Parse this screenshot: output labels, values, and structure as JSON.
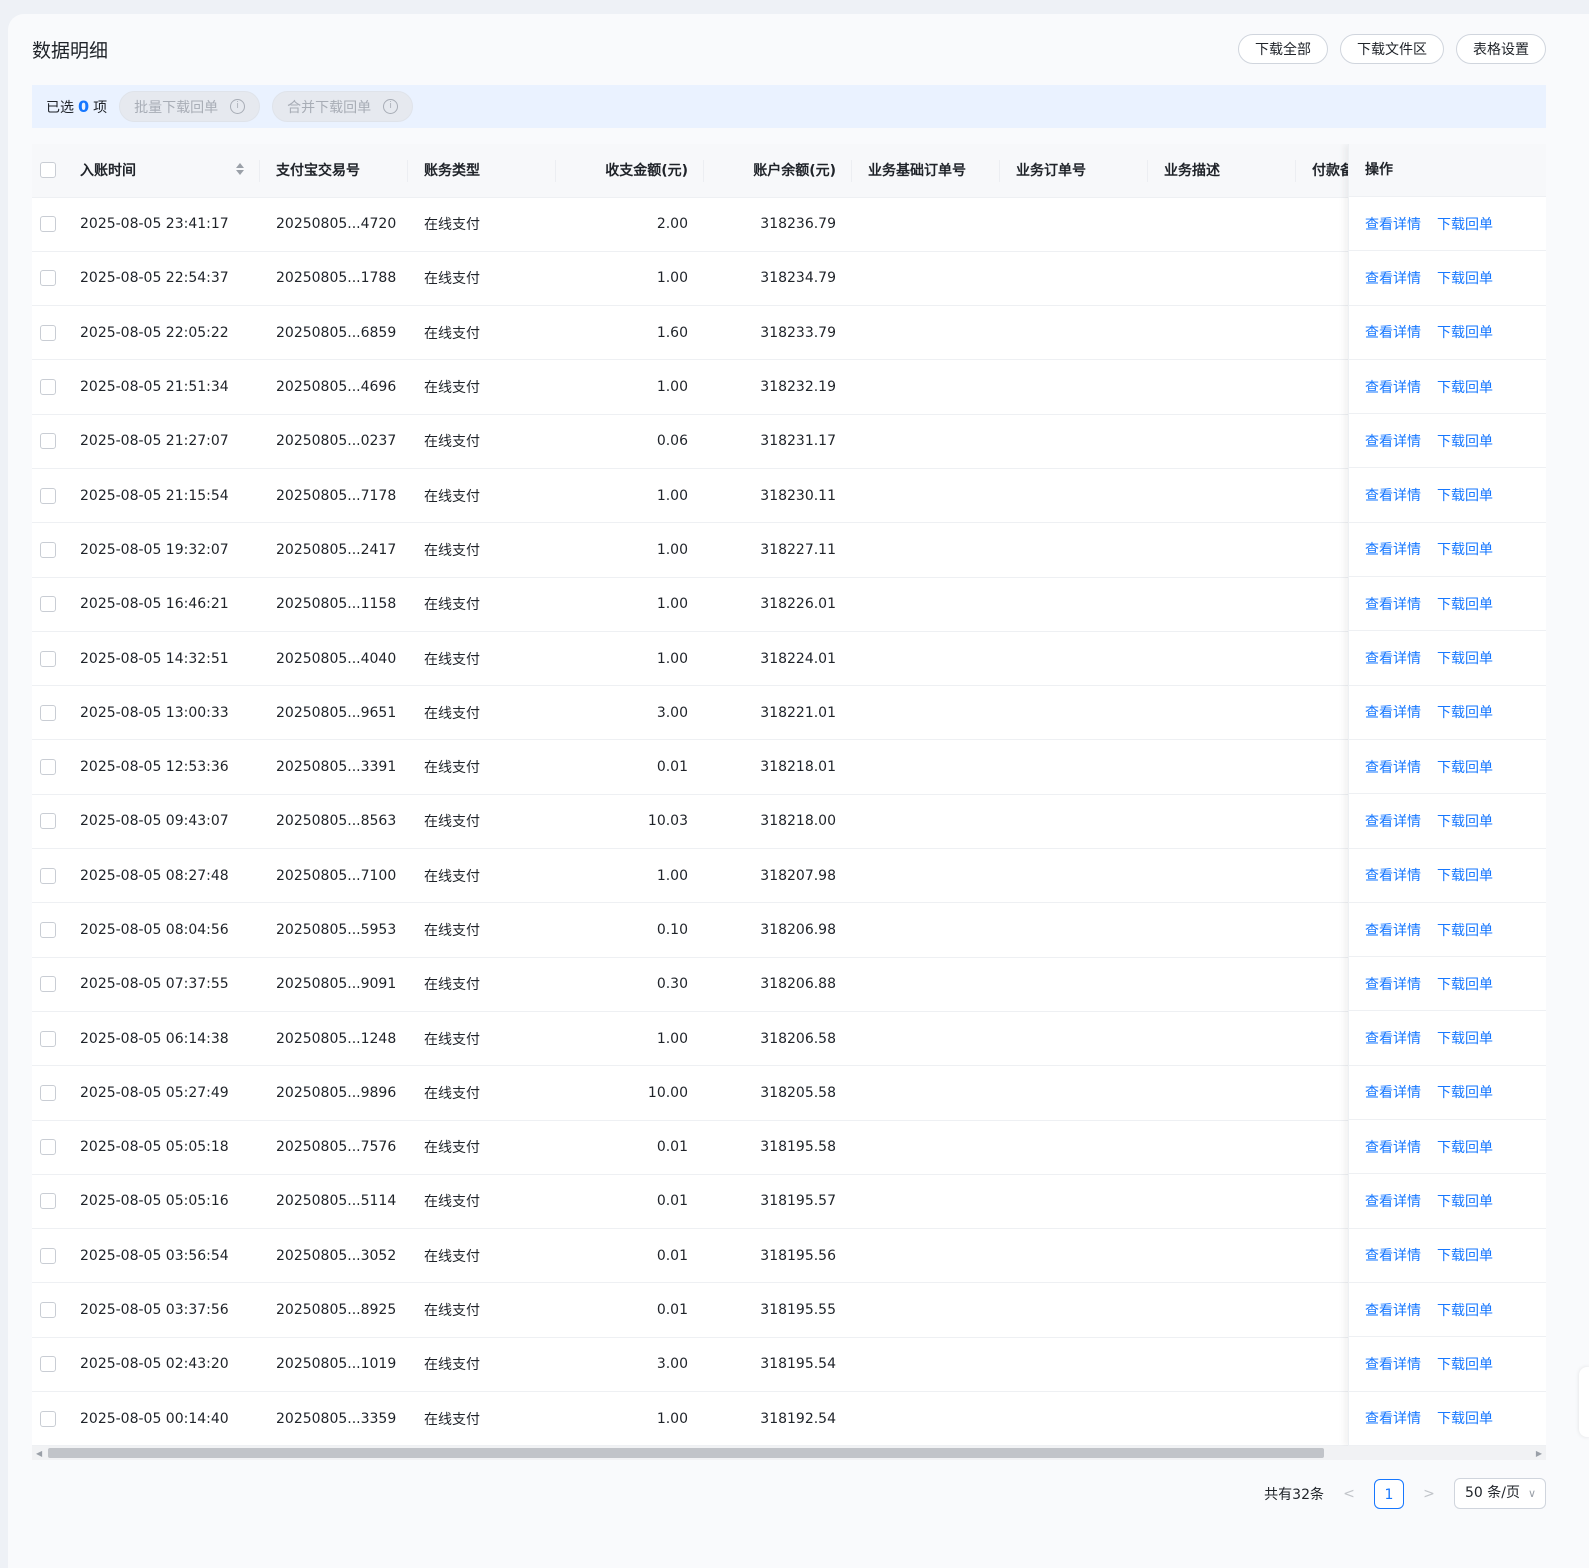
{
  "page": {
    "title": "数据明细"
  },
  "toolbar": {
    "download_all": "下载全部",
    "download_area": "下载文件区",
    "table_settings": "表格设置"
  },
  "selection": {
    "prefix": "已选",
    "count": "0",
    "suffix": "项",
    "batch_download": "批量下载回单",
    "merge_download": "合并下载回单"
  },
  "table": {
    "columns": {
      "time": "入账时间",
      "trade_no": "支付宝交易号",
      "type": "账务类型",
      "amount": "收支金额(元)",
      "balance": "账户余额(元)",
      "base_order": "业务基础订单号",
      "order": "业务订单号",
      "desc": "业务描述",
      "payer": "付款备",
      "actions": "操作"
    },
    "action_labels": {
      "detail": "查看详情",
      "download": "下载回单"
    },
    "rows": [
      {
        "time": "2025-08-05 23:41:17",
        "trade_no": "20250805...4720",
        "type": "在线支付",
        "amount": "2.00",
        "balance": "318236.79"
      },
      {
        "time": "2025-08-05 22:54:37",
        "trade_no": "20250805...1788",
        "type": "在线支付",
        "amount": "1.00",
        "balance": "318234.79"
      },
      {
        "time": "2025-08-05 22:05:22",
        "trade_no": "20250805...6859",
        "type": "在线支付",
        "amount": "1.60",
        "balance": "318233.79"
      },
      {
        "time": "2025-08-05 21:51:34",
        "trade_no": "20250805...4696",
        "type": "在线支付",
        "amount": "1.00",
        "balance": "318232.19"
      },
      {
        "time": "2025-08-05 21:27:07",
        "trade_no": "20250805...0237",
        "type": "在线支付",
        "amount": "0.06",
        "balance": "318231.17"
      },
      {
        "time": "2025-08-05 21:15:54",
        "trade_no": "20250805...7178",
        "type": "在线支付",
        "amount": "1.00",
        "balance": "318230.11"
      },
      {
        "time": "2025-08-05 19:32:07",
        "trade_no": "20250805...2417",
        "type": "在线支付",
        "amount": "1.00",
        "balance": "318227.11"
      },
      {
        "time": "2025-08-05 16:46:21",
        "trade_no": "20250805...1158",
        "type": "在线支付",
        "amount": "1.00",
        "balance": "318226.01"
      },
      {
        "time": "2025-08-05 14:32:51",
        "trade_no": "20250805...4040",
        "type": "在线支付",
        "amount": "1.00",
        "balance": "318224.01"
      },
      {
        "time": "2025-08-05 13:00:33",
        "trade_no": "20250805...9651",
        "type": "在线支付",
        "amount": "3.00",
        "balance": "318221.01"
      },
      {
        "time": "2025-08-05 12:53:36",
        "trade_no": "20250805...3391",
        "type": "在线支付",
        "amount": "0.01",
        "balance": "318218.01"
      },
      {
        "time": "2025-08-05 09:43:07",
        "trade_no": "20250805...8563",
        "type": "在线支付",
        "amount": "10.03",
        "balance": "318218.00"
      },
      {
        "time": "2025-08-05 08:27:48",
        "trade_no": "20250805...7100",
        "type": "在线支付",
        "amount": "1.00",
        "balance": "318207.98"
      },
      {
        "time": "2025-08-05 08:04:56",
        "trade_no": "20250805...5953",
        "type": "在线支付",
        "amount": "0.10",
        "balance": "318206.98"
      },
      {
        "time": "2025-08-05 07:37:55",
        "trade_no": "20250805...9091",
        "type": "在线支付",
        "amount": "0.30",
        "balance": "318206.88"
      },
      {
        "time": "2025-08-05 06:14:38",
        "trade_no": "20250805...1248",
        "type": "在线支付",
        "amount": "1.00",
        "balance": "318206.58"
      },
      {
        "time": "2025-08-05 05:27:49",
        "trade_no": "20250805...9896",
        "type": "在线支付",
        "amount": "10.00",
        "balance": "318205.58"
      },
      {
        "time": "2025-08-05 05:05:18",
        "trade_no": "20250805...7576",
        "type": "在线支付",
        "amount": "0.01",
        "balance": "318195.58"
      },
      {
        "time": "2025-08-05 05:05:16",
        "trade_no": "20250805...5114",
        "type": "在线支付",
        "amount": "0.01",
        "balance": "318195.57"
      },
      {
        "time": "2025-08-05 03:56:54",
        "trade_no": "20250805...3052",
        "type": "在线支付",
        "amount": "0.01",
        "balance": "318195.56"
      },
      {
        "time": "2025-08-05 03:37:56",
        "trade_no": "20250805...8925",
        "type": "在线支付",
        "amount": "0.01",
        "balance": "318195.55"
      },
      {
        "time": "2025-08-05 02:43:20",
        "trade_no": "20250805...1019",
        "type": "在线支付",
        "amount": "3.00",
        "balance": "318195.54"
      },
      {
        "time": "2025-08-05 00:14:40",
        "trade_no": "20250805...3359",
        "type": "在线支付",
        "amount": "1.00",
        "balance": "318192.54"
      }
    ]
  },
  "pagination": {
    "total": "共有32条",
    "current": "1",
    "page_size": "50 条/页"
  },
  "icons": {
    "info": "info-icon",
    "sort": "sort-icon",
    "prev": "chevron-left-icon",
    "next": "chevron-right-icon",
    "dropdown": "chevron-down-icon"
  },
  "colors": {
    "accent": "#1677ff",
    "selection_bar": "#eaf2ff"
  }
}
